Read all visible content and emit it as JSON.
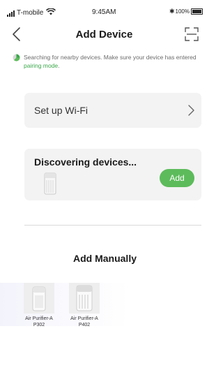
{
  "status_bar": {
    "carrier": "T-mobile",
    "time": "9:45AM",
    "battery": "100%"
  },
  "header": {
    "title": "Add Device"
  },
  "notice": {
    "text": "Searching for nearby devices. Make sure your device has entered ",
    "link_text": "pairing mode",
    "suffix": "."
  },
  "wifi_card": {
    "label": "Set up Wi-Fi"
  },
  "discovering_card": {
    "label": "Discovering devices...",
    "add_label": "Add"
  },
  "manual": {
    "title": "Add Manually",
    "items": [
      {
        "name": "Air Purifier-A",
        "model": "P302"
      },
      {
        "name": "Air Purifier-A",
        "model": "P402"
      }
    ]
  },
  "colors": {
    "accent": "#5dbb5b",
    "link": "#3aa74a",
    "card_bg": "#f3f3f3"
  }
}
